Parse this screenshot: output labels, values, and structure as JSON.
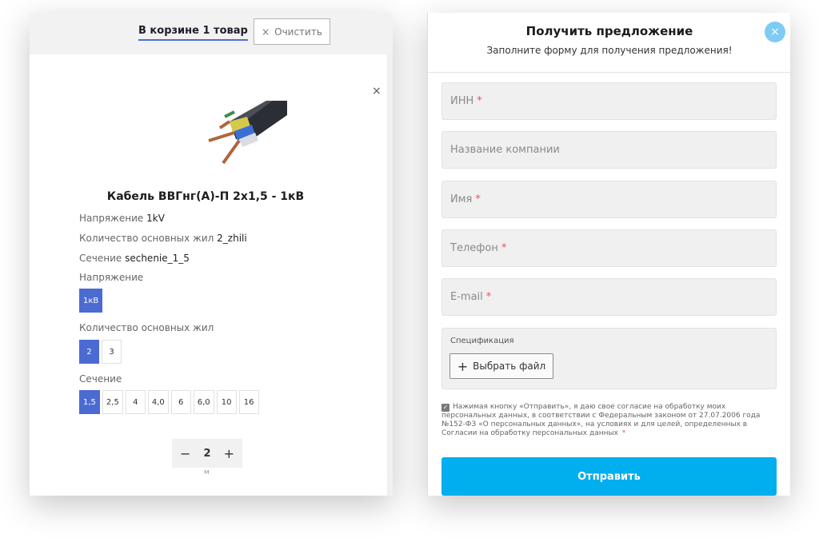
{
  "cart": {
    "count_label": "В корзине 1 товар",
    "clear_label": "Очистить",
    "clear_icon": "×",
    "close_icon": "×",
    "product": {
      "image_icon": "cable-image",
      "title": "Кабель ВВГнг(А)-П 2х1,5 - 1кВ",
      "props": [
        {
          "label": "Напряжение",
          "value": "1kV"
        },
        {
          "label": "Количество основных жил",
          "value": "2_zhili"
        },
        {
          "label": "Сечение",
          "value": "sechenie_1_5"
        }
      ],
      "groups": [
        {
          "label": "Напряжение",
          "options": [
            "1кВ"
          ],
          "selected": 0
        },
        {
          "label": "Количество основных жил",
          "options": [
            "2",
            "3"
          ],
          "selected": 0
        },
        {
          "label": "Сечение",
          "options": [
            "1,5",
            "2,5",
            "4",
            "4,0",
            "6",
            "6,0",
            "10",
            "16"
          ],
          "selected": 0
        }
      ]
    },
    "quantity": {
      "minus": "−",
      "value": "2",
      "plus": "+",
      "unit": "м"
    }
  },
  "form": {
    "title": "Получить предложение",
    "subtitle": "Заполните форму для получения предложения!",
    "close_icon": "×",
    "fields": [
      {
        "placeholder": "ИНН",
        "required": true
      },
      {
        "placeholder": "Название компании",
        "required": false
      },
      {
        "placeholder": "Имя",
        "required": true
      },
      {
        "placeholder": "Телефон",
        "required": true
      },
      {
        "placeholder": "E-mail",
        "required": true
      }
    ],
    "required_mark": "*",
    "spec_label": "Спецификация",
    "file_button_icon": "+",
    "file_button_label": "Выбрать файл",
    "consent_checked": true,
    "consent_text": "Нажимая кнопку «Отправить», я даю свое согласие на обработку моих персональных данных, в соответствии с Федеральным законом от 27.07.2006 года №152-ФЗ «О персональных данных», на условиях и для целей, определенных в Согласии на обработку персональных данных",
    "submit_label": "Отправить"
  },
  "colors": {
    "accent_blue": "#4b6bd3",
    "submit": "#01aeee",
    "close_button": "#7ecbf4",
    "required": "#e45757"
  }
}
